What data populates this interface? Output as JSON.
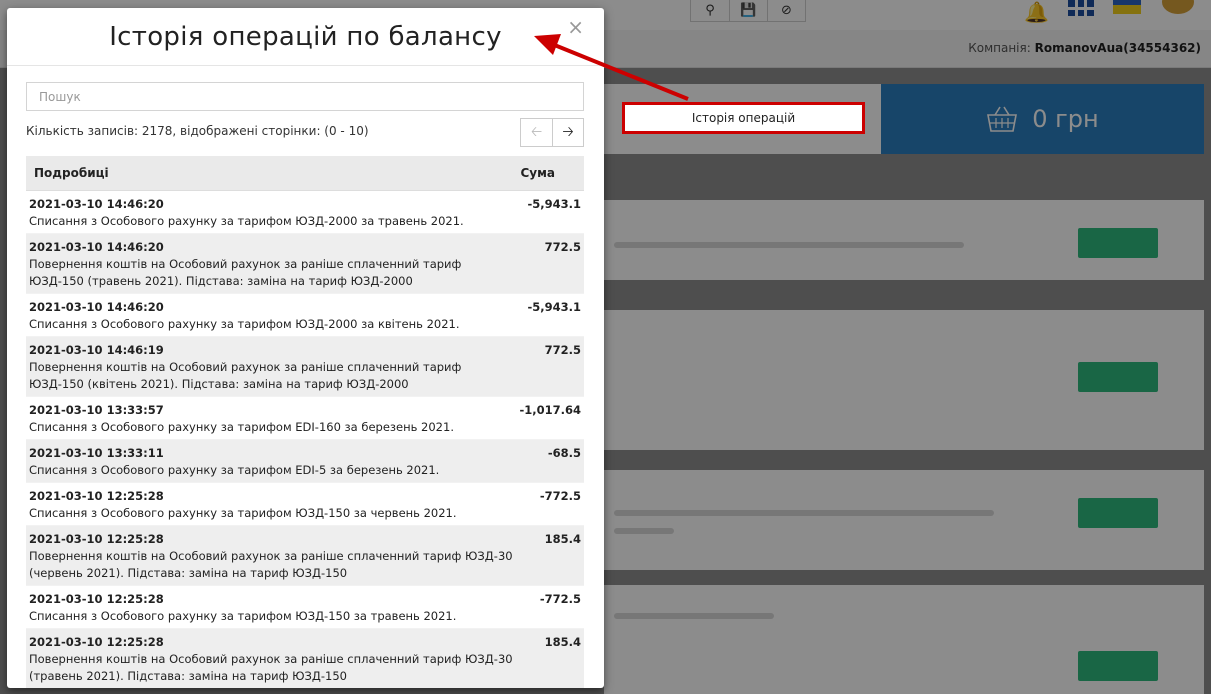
{
  "background": {
    "company_label": "Компанія:",
    "company_name": "RomanovAua(34554362)",
    "history_button_label": "Історія операцій",
    "balance": "0 грн",
    "icons": [
      "search-icon",
      "save-icon",
      "cancel-icon",
      "bell-icon",
      "apps-grid-icon",
      "flag-ua-icon",
      "avatar",
      "basket-icon"
    ]
  },
  "modal": {
    "title": "Історія операцій по балансу",
    "close_label": "×",
    "search_placeholder": "Пошук",
    "records_info": "Кількість записів: 2178, відображені сторінки: (0 - 10)",
    "pager": {
      "prev": "🡠",
      "next": "🡢"
    },
    "columns": {
      "details": "Подробиці",
      "amount": "Сума"
    },
    "rows": [
      {
        "datetime": "2021-03-10 14:46:20",
        "description": "Списання з Особового рахунку за тарифом ЮЗД-2000 за травень 2021.",
        "amount": "-5,943.1"
      },
      {
        "datetime": "2021-03-10 14:46:20",
        "description": "Повернення коштів на Особовий рахунок за раніше сплаченний тариф ЮЗД-150 (травень 2021). Підстава: заміна на тариф ЮЗД-2000",
        "amount": "772.5"
      },
      {
        "datetime": "2021-03-10 14:46:20",
        "description": "Списання з Особового рахунку за тарифом ЮЗД-2000 за квітень 2021.",
        "amount": "-5,943.1"
      },
      {
        "datetime": "2021-03-10 14:46:19",
        "description": "Повернення коштів на Особовий рахунок за раніше сплаченний тариф ЮЗД-150 (квітень 2021). Підстава: заміна на тариф ЮЗД-2000",
        "amount": "772.5"
      },
      {
        "datetime": "2021-03-10 13:33:57",
        "description": "Списання з Особового рахунку за тарифом EDI-160 за березень 2021.",
        "amount": "-1,017.64"
      },
      {
        "datetime": "2021-03-10 13:33:11",
        "description": "Списання з Особового рахунку за тарифом EDI-5 за березень 2021.",
        "amount": "-68.5"
      },
      {
        "datetime": "2021-03-10 12:25:28",
        "description": "Списання з Особового рахунку за тарифом ЮЗД-150 за червень 2021.",
        "amount": "-772.5"
      },
      {
        "datetime": "2021-03-10 12:25:28",
        "description": "Повернення коштів на Особовий рахунок за раніше сплаченний тариф ЮЗД-30 (червень 2021). Підстава: заміна на тариф ЮЗД-150",
        "amount": "185.4"
      },
      {
        "datetime": "2021-03-10 12:25:28",
        "description": "Списання з Особового рахунку за тарифом ЮЗД-150 за травень 2021.",
        "amount": "-772.5"
      },
      {
        "datetime": "2021-03-10 12:25:28",
        "description": "Повернення коштів на Особовий рахунок за раніше сплаченний тариф ЮЗД-30 (травень 2021). Підстава: заміна на тариф ЮЗД-150",
        "amount": "185.4"
      }
    ]
  },
  "annotation": {
    "color": "#cc0000"
  }
}
